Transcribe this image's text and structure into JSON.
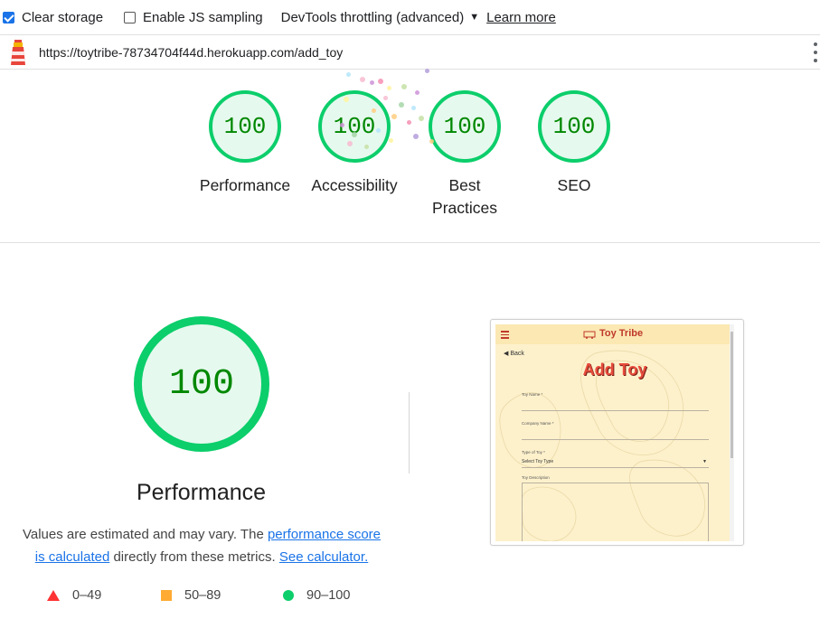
{
  "toolbar": {
    "clear_storage": {
      "label": "Clear storage",
      "checked": true
    },
    "js_sampling": {
      "label": "Enable JS sampling",
      "checked": false
    },
    "throttling_label": "DevTools throttling (advanced)",
    "learn_more": "Learn more"
  },
  "urlbar": {
    "url": "https://toytribe-78734704f44d.herokuapp.com/add_toy"
  },
  "gauges": [
    {
      "score": "100",
      "label": "Performance"
    },
    {
      "score": "100",
      "label": "Accessibility"
    },
    {
      "score": "100",
      "label": "Best Practices"
    },
    {
      "score": "100",
      "label": "SEO"
    }
  ],
  "performance": {
    "score": "100",
    "title": "Performance",
    "desc_prefix": "Values are estimated and may vary. The ",
    "desc_link1": "performance score is calculated",
    "desc_middle": " directly from these metrics. ",
    "desc_link2": "See calculator."
  },
  "legend": [
    {
      "range": "0–49",
      "color": "#ff3333"
    },
    {
      "range": "50–89",
      "color": "#ffaa33"
    },
    {
      "range": "90–100",
      "color": "#0cce6b"
    }
  ],
  "thumbnail": {
    "brand": "Toy Tribe",
    "back": "Back",
    "heading": "Add Toy",
    "fields": {
      "toy_name": "Toy Name *",
      "company_name": "Company Name *",
      "type_of_toy": "Type of Toy *",
      "type_select": "Select Toy Type",
      "description": "Toy Description"
    }
  },
  "colors": {
    "pass_green": "#0cce6b",
    "pass_text": "#008800",
    "pass_fill": "#e6f9ee",
    "link_blue": "#1a73e8",
    "thumb_bg": "#fdf1cc",
    "thumb_accent": "#e74c3c"
  }
}
